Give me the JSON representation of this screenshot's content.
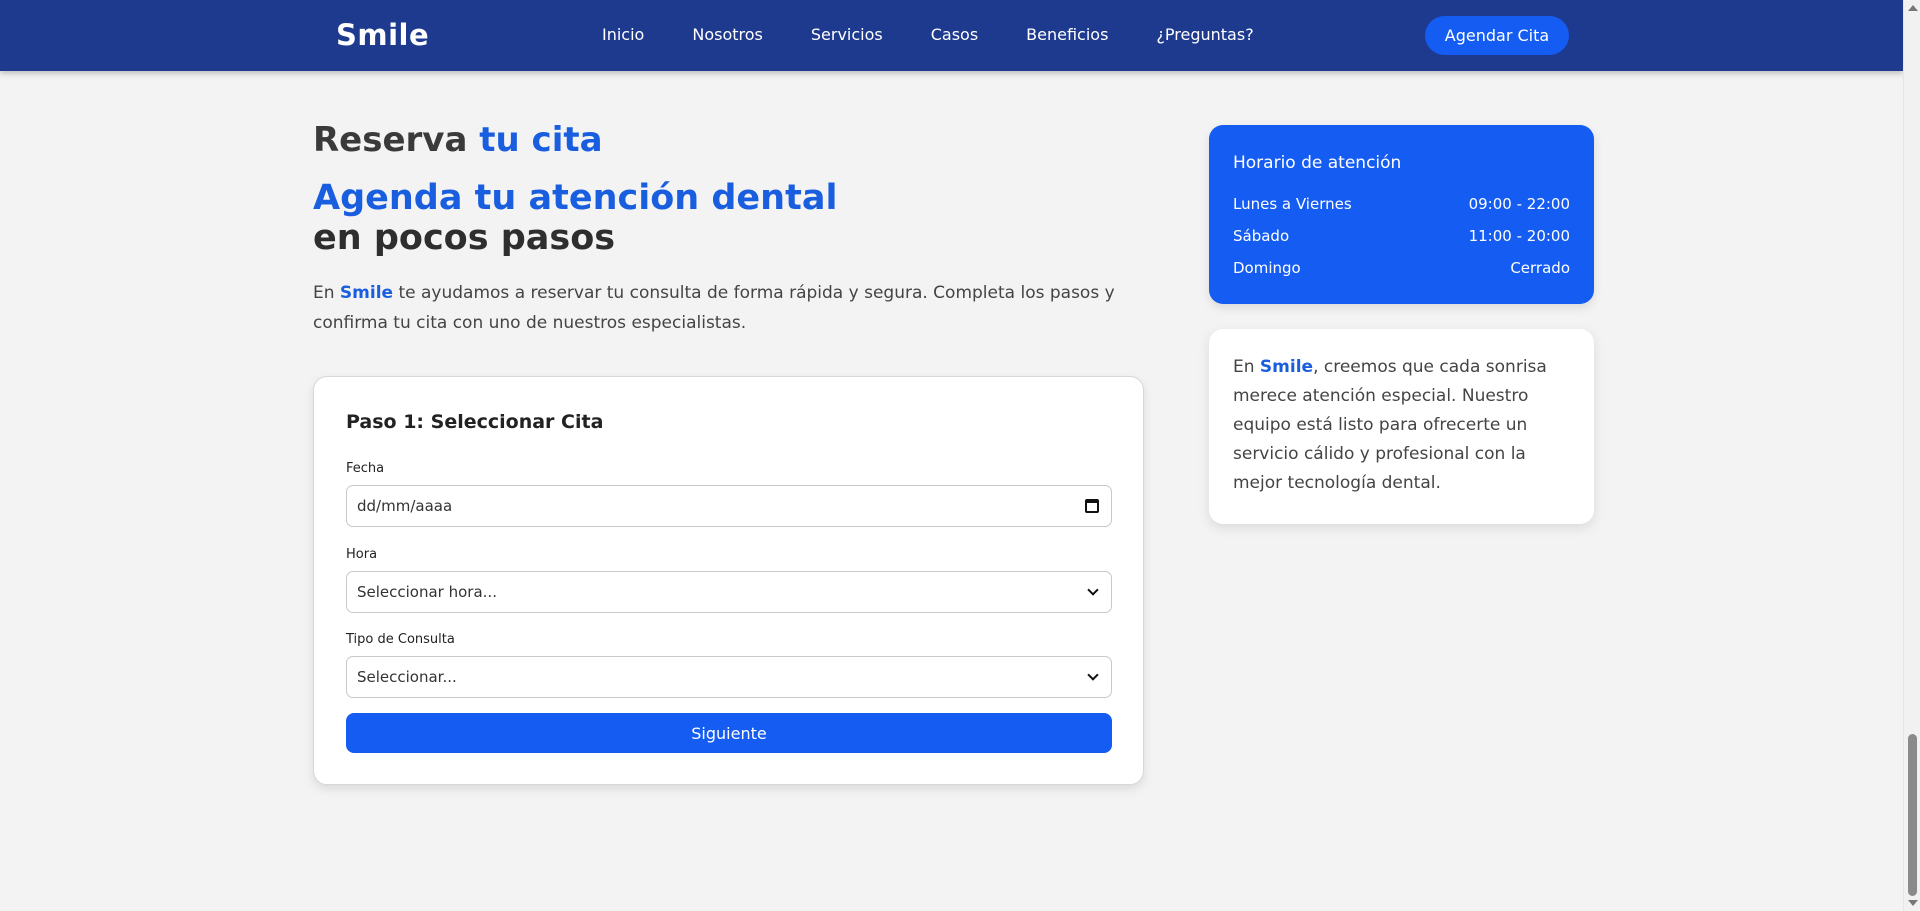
{
  "navbar": {
    "logo": "Smile",
    "links": [
      "Inicio",
      "Nosotros",
      "Servicios",
      "Casos",
      "Beneficios",
      "¿Preguntas?"
    ],
    "cta_label": "Agendar Cita",
    "background_color": "#1e3a8f"
  },
  "hero": {
    "kicker_prefix": "Reserva",
    "kicker_accent": "tu cita",
    "headline_line1": "Agenda tu atención dental",
    "headline_line2": "en pocos pasos",
    "intro_prefix": "En",
    "intro_brand": "Smile",
    "intro_rest": "te ayudamos a reservar tu consulta de forma rápida y segura. Completa los pasos y confirma tu cita con uno de nuestros especialistas."
  },
  "form": {
    "step_title": "Paso 1: Seleccionar Cita",
    "date_label": "Fecha",
    "date_placeholder": "dd/mm/aaaa",
    "time_label": "Hora",
    "time_selected": "Seleccionar hora...",
    "type_label": "Tipo de Consulta",
    "type_selected": "Seleccionar...",
    "next_label": "Siguiente"
  },
  "hours": {
    "title": "Horario de atención",
    "rows": [
      {
        "day": "Lunes a Viernes",
        "time": "09:00 - 22:00"
      },
      {
        "day": "Sábado",
        "time": "11:00 - 20:00"
      },
      {
        "day": "Domingo",
        "time": "Cerrado"
      }
    ]
  },
  "about": {
    "prefix": "En",
    "brand": "Smile",
    "rest": ", creemos que cada sonrisa merece atención especial. Nuestro equipo está listo para ofrecerte un servicio cálido y profesional con la mejor tecnología dental."
  },
  "colors": {
    "accent": "#155cf2",
    "brand_text": "#1a5ee0",
    "page_bg": "#f3f3f3"
  }
}
